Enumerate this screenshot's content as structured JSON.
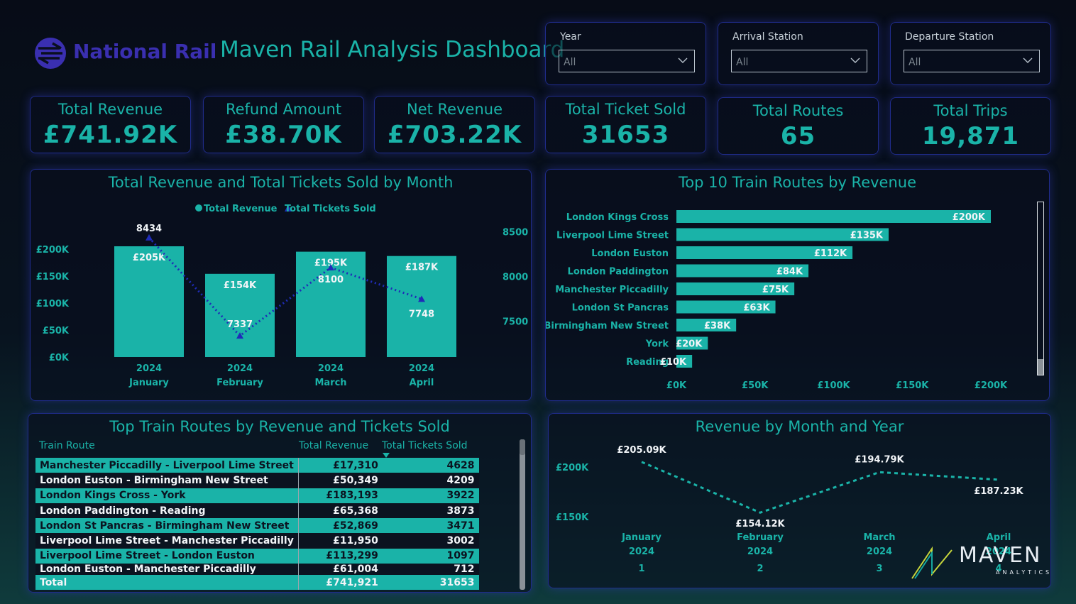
{
  "header": {
    "brand": "National Rail",
    "title": "Maven Rail Analysis Dashboard"
  },
  "filters": [
    {
      "label": "Year",
      "value": "All"
    },
    {
      "label": "Arrival Station",
      "value": "All"
    },
    {
      "label": "Departure Station",
      "value": "All"
    }
  ],
  "kpis": [
    {
      "label": "Total Revenue",
      "value": "£741.92K"
    },
    {
      "label": "Refund Amount",
      "value": "£38.70K"
    },
    {
      "label": "Net Revenue",
      "value": "£703.22K"
    },
    {
      "label": "Total Ticket Sold",
      "value": "31653"
    },
    {
      "label": "Total Routes",
      "value": "65"
    },
    {
      "label": "Total Trips",
      "value": "19,871"
    }
  ],
  "colors": {
    "accent": "#1ab3a8",
    "line": "#1f2cb8",
    "panel_border": "#1f2b8a"
  },
  "chart_data": [
    {
      "type": "bar",
      "title": "Total Revenue and Total Tickets Sold by Month",
      "legend": [
        "Total Revenue",
        "Total Tickets Sold"
      ],
      "legend_position": "top-center",
      "categories": [
        [
          "2024",
          "January"
        ],
        [
          "2024",
          "February"
        ],
        [
          "2024",
          "March"
        ],
        [
          "2024",
          "April"
        ]
      ],
      "series": [
        {
          "name": "Total Revenue",
          "type": "bar",
          "values": [
            205,
            154,
            195,
            187
          ],
          "labels": [
            "£205K",
            "£154K",
            "£195K",
            "£187K"
          ]
        },
        {
          "name": "Total Tickets Sold",
          "type": "line",
          "values": [
            8434,
            7337,
            8100,
            7748
          ],
          "labels": [
            "8434",
            "7337",
            "8100",
            "7748"
          ]
        }
      ],
      "y_left": {
        "ticks": [
          "£0K",
          "£50K",
          "£100K",
          "£150K",
          "£200K"
        ],
        "tick_values": [
          0,
          50,
          100,
          150,
          200
        ],
        "range": [
          0,
          205
        ]
      },
      "y_right": {
        "ticks": [
          "7500",
          "8000",
          "8500"
        ],
        "tick_values": [
          7500,
          8000,
          8500
        ],
        "range": [
          7100,
          8600
        ]
      }
    },
    {
      "type": "bar",
      "orientation": "horizontal",
      "title": "Top 10 Train Routes by Revenue",
      "categories": [
        "London Kings Cross",
        "Liverpool Lime Street",
        "London Euston",
        "London Paddington",
        "Manchester Piccadilly",
        "London St Pancras",
        "Birmingham New Street",
        "York",
        "Reading"
      ],
      "values": [
        200,
        135,
        112,
        84,
        75,
        63,
        38,
        20,
        10
      ],
      "labels": [
        "£200K",
        "£135K",
        "£112K",
        "£84K",
        "£75K",
        "£63K",
        "£38K",
        "£20K",
        "£10K"
      ],
      "x_ticks": [
        "£0K",
        "£50K",
        "£100K",
        "£150K",
        "£200K"
      ],
      "x_tick_values": [
        0,
        50,
        100,
        150,
        200
      ],
      "xlim": [
        0,
        200
      ]
    },
    {
      "type": "table",
      "title": "Top Train Routes by Revenue and Tickets Sold",
      "columns": [
        "Train Route",
        "Total Revenue",
        "Total Tickets Sold"
      ],
      "rows": [
        [
          "Manchester Piccadilly - Liverpool Lime Street",
          "£17,310",
          "4628"
        ],
        [
          "London Euston - Birmingham New Street",
          "£50,349",
          "4209"
        ],
        [
          "London Kings Cross - York",
          "£183,193",
          "3922"
        ],
        [
          "London Paddington - Reading",
          "£65,368",
          "3873"
        ],
        [
          "London St Pancras - Birmingham New Street",
          "£52,869",
          "3471"
        ],
        [
          "Liverpool Lime Street - Manchester Piccadilly",
          "£11,950",
          "3002"
        ],
        [
          "Liverpool Lime Street - London Euston",
          "£113,299",
          "1097"
        ],
        [
          "London Euston - Manchester Piccadilly",
          "£61,004",
          "712"
        ]
      ],
      "total": [
        "Total",
        "£741,921",
        "31653"
      ]
    },
    {
      "type": "line",
      "title": "Revenue by Month and Year",
      "x": [
        [
          "January",
          "2024",
          "1"
        ],
        [
          "February",
          "2024",
          "2"
        ],
        [
          "March",
          "2024",
          "3"
        ],
        [
          "April",
          "2024",
          "4"
        ]
      ],
      "values": [
        205.09,
        154.12,
        194.79,
        187.23
      ],
      "labels": [
        "£205.09K",
        "£154.12K",
        "£194.79K",
        "£187.23K"
      ],
      "y_ticks": [
        "£150K",
        "£200K"
      ],
      "y_tick_values": [
        150,
        200
      ]
    }
  ],
  "watermark": {
    "brand": "MAVEN",
    "sub": "ANALYTICS"
  }
}
